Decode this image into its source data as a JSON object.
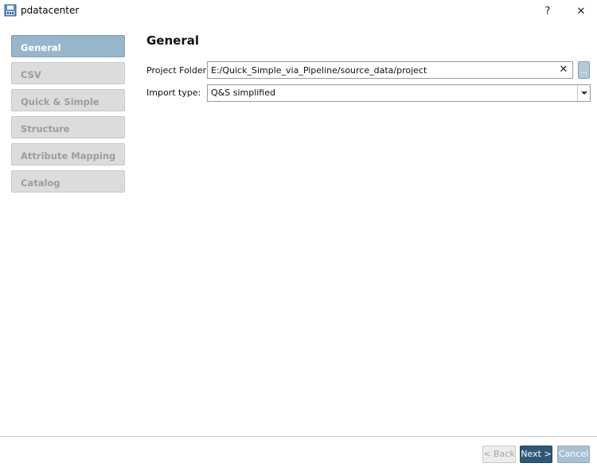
{
  "window": {
    "title": "pdatacenter",
    "help_label": "?",
    "close_label": "✕"
  },
  "nav": {
    "items": [
      {
        "label": "General",
        "active": true
      },
      {
        "label": "CSV",
        "active": false
      },
      {
        "label": "Quick & Simple",
        "active": false
      },
      {
        "label": "Structure",
        "active": false
      },
      {
        "label": "Attribute Mapping",
        "active": false
      },
      {
        "label": "Catalog",
        "active": false
      }
    ]
  },
  "main": {
    "title": "General",
    "project_folder": {
      "label": "Project Folder:",
      "value": "E:/Quick_Simple_via_Pipeline/source_data/project",
      "clear_label": "✕",
      "browse_label": "..."
    },
    "import_type": {
      "label": "Import type:",
      "selected": "Q&S simplified"
    }
  },
  "footer": {
    "back_label": "< Back",
    "next_label": "Next >",
    "cancel_label": "Cancel"
  },
  "colors": {
    "nav_active": "#98b6cb",
    "nav_inactive": "#dcdcdc",
    "primary_button": "#2e5878",
    "secondary_button": "#a8c0d2"
  },
  "icons": {
    "app": "floppy-disk-icon",
    "dropdown": "chevron-down-icon"
  }
}
